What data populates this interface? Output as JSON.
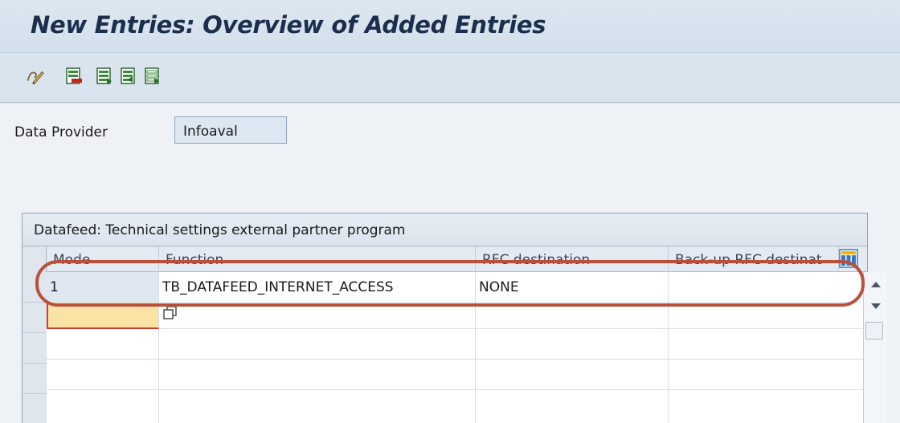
{
  "window": {
    "title": "New Entries: Overview of Added Entries"
  },
  "toolbar": {
    "buttons": [
      {
        "icon": "change-display-icon",
        "label": ""
      },
      {
        "icon": "delete-entry-icon",
        "label": ""
      },
      {
        "icon": "copy-entry-icon",
        "label": ""
      },
      {
        "icon": "select-all-icon",
        "label": ""
      },
      {
        "icon": "deselect-all-icon",
        "label": ""
      }
    ]
  },
  "form": {
    "data_provider_label": "Data Provider",
    "data_provider_value": "Infoaval"
  },
  "table": {
    "title": "Datafeed: Technical settings external partner program",
    "columns": [
      "Mode",
      "Function",
      "RFC destination",
      "Back-up RFC destinat"
    ],
    "rows": [
      {
        "mode": "1",
        "function": "TB_DATAFEED_INTERNET_ACCESS",
        "rfc_destination": "NONE",
        "backup_rfc": ""
      },
      {
        "mode": "",
        "function": "",
        "rfc_destination": "",
        "backup_rfc": ""
      },
      {
        "mode": "",
        "function": "",
        "rfc_destination": "",
        "backup_rfc": ""
      },
      {
        "mode": "",
        "function": "",
        "rfc_destination": "",
        "backup_rfc": ""
      },
      {
        "mode": "",
        "function": "",
        "rfc_destination": "",
        "backup_rfc": ""
      }
    ]
  },
  "colors": {
    "highlight": "#b8503b",
    "title_text": "#1b2f4d",
    "new_entry_cell": "#fbe3a6"
  }
}
